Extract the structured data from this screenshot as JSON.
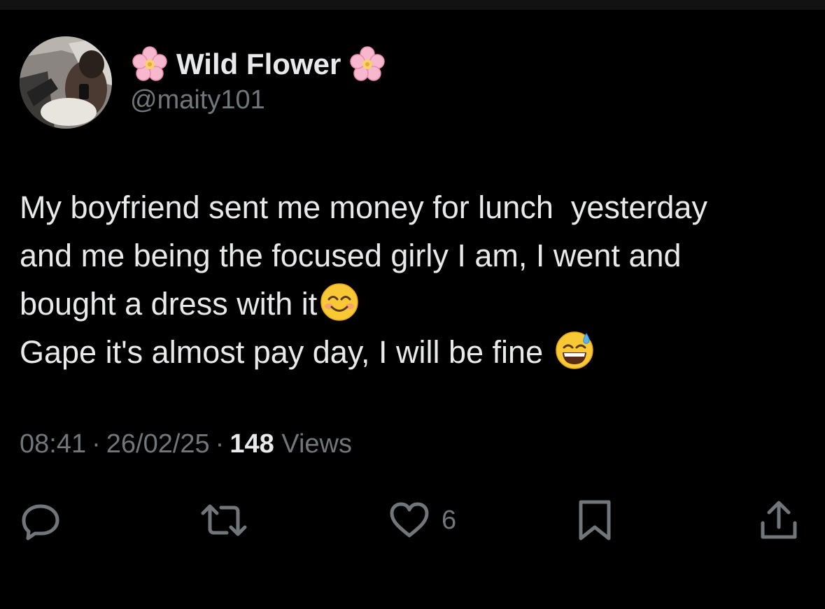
{
  "user": {
    "display_name": "Wild Flower",
    "handle": "@maity101"
  },
  "tweet": {
    "lines": [
      "My boyfriend sent me money for lunch  yesterday",
      "and me being the focused girly I am, I went and",
      "bought a dress with it",
      "Gape it's almost pay day, I will be fine"
    ],
    "emojis": [
      "smiling-face-with-smiling-eyes",
      "grinning-face-with-sweat"
    ]
  },
  "meta": {
    "time": "08:41",
    "date": "26/02/25",
    "views_count": "148",
    "views_label": "Views",
    "separator": "·"
  },
  "actions": {
    "reply": {
      "icon": "reply-icon"
    },
    "retweet": {
      "icon": "retweet-icon"
    },
    "like": {
      "icon": "heart-icon",
      "count": "6"
    },
    "bookmark": {
      "icon": "bookmark-icon"
    },
    "share": {
      "icon": "share-icon"
    }
  },
  "colors": {
    "background": "#000000",
    "text_primary": "#e7e9ea",
    "text_secondary": "#71767b"
  }
}
